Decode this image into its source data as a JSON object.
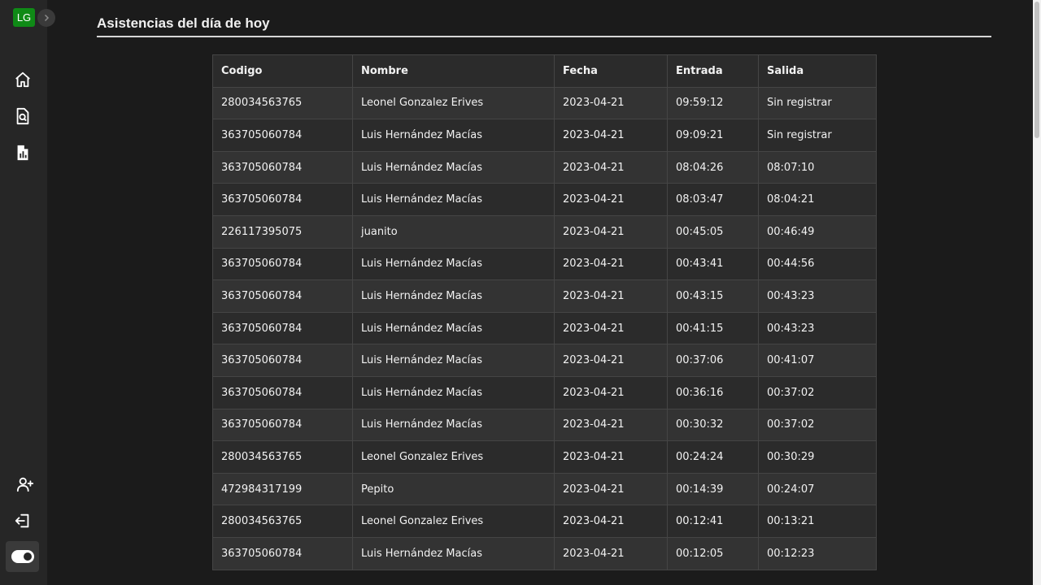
{
  "sidebar": {
    "avatar_initials": "LG",
    "top_items": [
      {
        "icon": "home-icon"
      },
      {
        "icon": "document-search-icon"
      },
      {
        "icon": "report-chart-icon"
      }
    ],
    "bottom_items": [
      {
        "icon": "add-user-icon"
      },
      {
        "icon": "logout-icon"
      },
      {
        "icon": "theme-toggle-icon"
      }
    ],
    "accent_color": "#0f8a16"
  },
  "main": {
    "title": "Asistencias del día de hoy"
  },
  "table": {
    "headers": [
      "Codigo",
      "Nombre",
      "Fecha",
      "Entrada",
      "Salida"
    ],
    "rows": [
      [
        "280034563765",
        "Leonel Gonzalez Erives",
        "2023-04-21",
        "09:59:12",
        "Sin registrar"
      ],
      [
        "363705060784",
        "Luis Hernández Macías",
        "2023-04-21",
        "09:09:21",
        "Sin registrar"
      ],
      [
        "363705060784",
        "Luis Hernández Macías",
        "2023-04-21",
        "08:04:26",
        "08:07:10"
      ],
      [
        "363705060784",
        "Luis Hernández Macías",
        "2023-04-21",
        "08:03:47",
        "08:04:21"
      ],
      [
        "226117395075",
        "juanito",
        "2023-04-21",
        "00:45:05",
        "00:46:49"
      ],
      [
        "363705060784",
        "Luis Hernández Macías",
        "2023-04-21",
        "00:43:41",
        "00:44:56"
      ],
      [
        "363705060784",
        "Luis Hernández Macías",
        "2023-04-21",
        "00:43:15",
        "00:43:23"
      ],
      [
        "363705060784",
        "Luis Hernández Macías",
        "2023-04-21",
        "00:41:15",
        "00:43:23"
      ],
      [
        "363705060784",
        "Luis Hernández Macías",
        "2023-04-21",
        "00:37:06",
        "00:41:07"
      ],
      [
        "363705060784",
        "Luis Hernández Macías",
        "2023-04-21",
        "00:36:16",
        "00:37:02"
      ],
      [
        "363705060784",
        "Luis Hernández Macías",
        "2023-04-21",
        "00:30:32",
        "00:37:02"
      ],
      [
        "280034563765",
        "Leonel Gonzalez Erives",
        "2023-04-21",
        "00:24:24",
        "00:30:29"
      ],
      [
        "472984317199",
        "Pepito",
        "2023-04-21",
        "00:14:39",
        "00:24:07"
      ],
      [
        "280034563765",
        "Leonel Gonzalez Erives",
        "2023-04-21",
        "00:12:41",
        "00:13:21"
      ],
      [
        "363705060784",
        "Luis Hernández Macías",
        "2023-04-21",
        "00:12:05",
        "00:12:23"
      ]
    ]
  }
}
